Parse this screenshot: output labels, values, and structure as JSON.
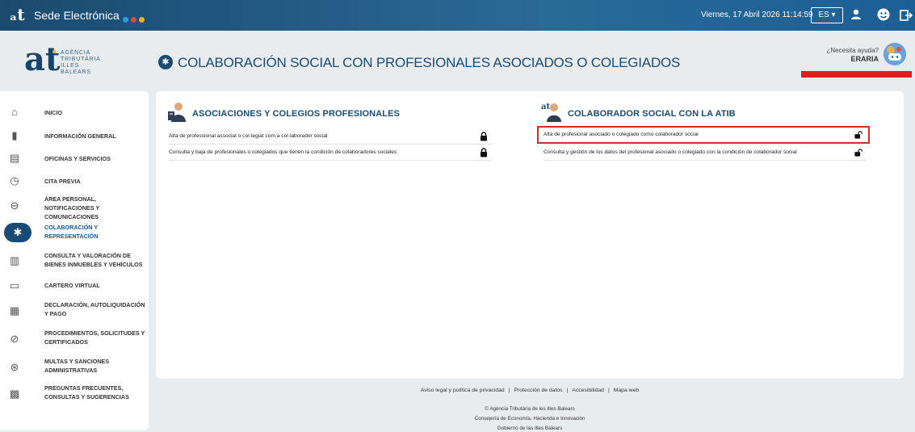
{
  "topbar": {
    "brand_glyph": "ₐt",
    "brand_title": "Sede Electrónica",
    "dot_colors": [
      "#2aa3d8",
      "#e04a3c",
      "#f2b21b"
    ],
    "datetime": "Viernes, 17 Abril 2026 11:14:59",
    "language": "ES ▾"
  },
  "logo": {
    "glyph": "at",
    "line1": "AGÈNCIA",
    "line2": "TRIBUTÀRIA",
    "line3": "ILLES BALEARS"
  },
  "page": {
    "title": "COLABORACIÓN SOCIAL CON PROFESIONALES ASOCIADOS O COLEGIADOS"
  },
  "help": {
    "question": "¿Necesita ayuda?",
    "name": "ERARIA"
  },
  "sidebar": {
    "items": [
      {
        "label": "INICIO",
        "icon": "home-icon",
        "glyph": "⌂"
      },
      {
        "label": "INFORMACIÓN GENERAL",
        "icon": "book-icon",
        "glyph": "▮"
      },
      {
        "label": "OFICINAS Y SERVICIOS",
        "icon": "building-icon",
        "glyph": "▤"
      },
      {
        "label": "CITA PREVIA",
        "icon": "calendar-icon",
        "glyph": "◷"
      },
      {
        "label": "ÁREA PERSONAL, NOTIFICACIONES Y COMUNICACIONES",
        "icon": "person-shield-icon",
        "glyph": "⊖"
      },
      {
        "label": "COLABORACIÓN Y REPRESENTACIÓN",
        "icon": "puzzle-icon",
        "glyph": "✱"
      },
      {
        "label": "CONSULTA Y VALORACIÓN DE BIENES INMUEBLES Y VEHÍCULOS",
        "icon": "city-icon",
        "glyph": "▥"
      },
      {
        "label": "CARTERO VIRTUAL",
        "icon": "laptop-icon",
        "glyph": "▭"
      },
      {
        "label": "DECLARACIÓN, AUTOLIQUIDACIÓN Y PAGO",
        "icon": "document-icon",
        "glyph": "▦"
      },
      {
        "label": "PROCEDIMIENTOS, SOLICITUDES Y CERTIFICADOS",
        "icon": "check-circle-icon",
        "glyph": "⊘"
      },
      {
        "label": "MULTAS Y SANCIONES ADMINISTRATIVAS",
        "icon": "badge-icon",
        "glyph": "⊛"
      },
      {
        "label": "PREGUNTAS FRECUENTES, CONSULTAS Y SUGERENCIAS",
        "icon": "faq-icon",
        "glyph": "▩"
      }
    ]
  },
  "left_section": {
    "title": "ASOCIACIONES Y COLEGIOS PROFESIONALES",
    "rows": [
      {
        "text": "Alta de professional associat o col·legiat com a col·laborador social",
        "icon": "lock-closed-icon"
      },
      {
        "text": "Consulta y baja de profesionales o colegiados que tienen la condición de colaboradores sociales",
        "icon": "lock-closed-icon"
      }
    ]
  },
  "right_section": {
    "title": "COLABORADOR SOCIAL CON LA ATIB",
    "rows": [
      {
        "text": "Alta de profesional asociado o colegiado como colaborador social",
        "icon": "lock-open-icon"
      },
      {
        "text": "Consulta y gestión de los datos del profesional asociado o colegiado con la condición de colaborador social",
        "icon": "lock-open-icon"
      }
    ]
  },
  "footer": {
    "links": [
      "Aviso legal y política de privacidad",
      "Protección de datos",
      "Accesibilidad",
      "Mapa web"
    ],
    "separator": "|",
    "copyright": "© Agència Tributària de les Illes Balears",
    "dept": "Consejería de Economía, Hacienda e Innovación",
    "gov": "Gobierno de las Illes Balears"
  }
}
